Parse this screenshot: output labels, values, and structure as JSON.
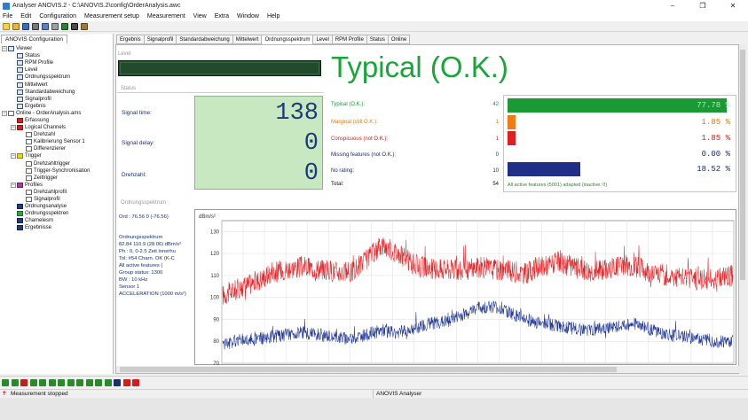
{
  "window": {
    "title": "Analyser ANOVIS.2 - C:\\ANOVIS.2\\config\\OrderAnalysis.awc",
    "minimize": "–",
    "restore": "❐",
    "close": "✕"
  },
  "menu": [
    "File",
    "Edit",
    "Configuration",
    "Measurement setup",
    "Measurement",
    "View",
    "Extra",
    "Window",
    "Help"
  ],
  "left_panel": {
    "tab_label": "ANOVIS Configuration",
    "tree": [
      {
        "label": "Viewer",
        "depth": 0,
        "icon": "viewer-icon",
        "exp": "−"
      },
      {
        "label": "Status",
        "depth": 1,
        "icon": "chart-icon"
      },
      {
        "label": "RPM Profile",
        "depth": 1,
        "icon": "chart-icon"
      },
      {
        "label": "Level",
        "depth": 1,
        "icon": "chart-icon"
      },
      {
        "label": "Ordnungsspektrum",
        "depth": 1,
        "icon": "chart-icon"
      },
      {
        "label": "Mittelwert",
        "depth": 1,
        "icon": "chart-icon"
      },
      {
        "label": "Standardabweichung",
        "depth": 1,
        "icon": "chart-icon"
      },
      {
        "label": "Signalprofil",
        "depth": 1,
        "icon": "chart-icon"
      },
      {
        "label": "Ergebnis",
        "depth": 1,
        "icon": "chart-icon"
      },
      {
        "label": "Online - OrderAnalysis.ams",
        "depth": 0,
        "icon": "online-icon",
        "exp": "−"
      },
      {
        "label": "Erfassung",
        "depth": 1,
        "icon": "red-icon"
      },
      {
        "label": "Logical Channels",
        "depth": 1,
        "icon": "red-icon",
        "exp": "−"
      },
      {
        "label": "Drehzahl",
        "depth": 2,
        "icon": "doc-icon"
      },
      {
        "label": "Kalibrierung Sensor 1",
        "depth": 2,
        "icon": "doc-icon"
      },
      {
        "label": "Differenzierer",
        "depth": 2,
        "icon": "doc-icon"
      },
      {
        "label": "Trigger",
        "depth": 1,
        "icon": "yellow-icon",
        "exp": "−"
      },
      {
        "label": "Drehzahltrigger",
        "depth": 2,
        "icon": "doc-icon"
      },
      {
        "label": "Trigger-Synchronisation",
        "depth": 2,
        "icon": "doc-icon"
      },
      {
        "label": "Zeittrigger",
        "depth": 2,
        "icon": "doc-icon"
      },
      {
        "label": "Profiles",
        "depth": 1,
        "icon": "magenta-icon",
        "exp": "−"
      },
      {
        "label": "Drehzahlprofil",
        "depth": 2,
        "icon": "doc-icon"
      },
      {
        "label": "Signalprofil",
        "depth": 2,
        "icon": "doc-icon"
      },
      {
        "label": "Ordnungsanalyse",
        "depth": 1,
        "icon": "dark-icon"
      },
      {
        "label": "Ordnungsspektren",
        "depth": 1,
        "icon": "green-icon"
      },
      {
        "label": "Chamelesm",
        "depth": 1,
        "icon": "dark-icon"
      },
      {
        "label": "Ergebnisse",
        "depth": 1,
        "icon": "dark-icon"
      }
    ]
  },
  "tabs": [
    "Ergebnis",
    "Signalprofil",
    "Standardabweichung",
    "Mittelwert",
    "Ordnungsspektrum",
    "Level",
    "RPM Profile",
    "Status",
    "Online"
  ],
  "active_tab": "Ordnungsspektrum",
  "level": {
    "group_label": "Level"
  },
  "verdict": {
    "text": "Typical (O.K.)",
    "color": "#19a53a"
  },
  "status": {
    "group_label": "Status",
    "signal_time_label": "Signal time:",
    "signal_time_value": "138",
    "signal_delay_label": "Signal delay:",
    "signal_delay_value": "0",
    "drehzahl_label": "Drehzahl:",
    "drehzahl_value": "0"
  },
  "results": [
    {
      "label": "Typical (O.K.):",
      "count": "42",
      "color": "#1a9a34",
      "pct": "77.78 %",
      "bar_fraction": 1.0
    },
    {
      "label": "Marginal (still O.K.):",
      "count": "1",
      "color": "#f07c15",
      "pct": "1.85 %",
      "bar_fraction": 0.035
    },
    {
      "label": "Conspicuous (not O.K.):",
      "count": "1",
      "color": "#e02020",
      "pct": "1.85 %",
      "bar_fraction": 0.035
    },
    {
      "label": "Missing features (not O.K.):",
      "count": "0",
      "color": "#1a2f6e",
      "pct": "0.00 %",
      "bar_fraction": 0.0
    },
    {
      "label": "No rating:",
      "count": "10",
      "color": "#1f2f88",
      "pct": "18.52 %",
      "bar_fraction": 0.33
    }
  ],
  "total": {
    "label": "Total:",
    "count": "54"
  },
  "adapted_note": "All active features (5001) adapted (inactive: 0)",
  "ordnung": {
    "group_label": "Ordnungsspektrum",
    "info_lines": [
      "Ord :        76.56   0   (-76.56)",
      "Ordnungsspektrum",
      "82.84   110.9  (28.06) dBm/s²",
      "Ph :         0, 0-2.5 Zeit innerhu",
      "Tol:          #54 Charn. OK (K-C",
      "               All active features (",
      "               Group status: 1300",
      "BW :         10 kHz",
      "Sensor 1",
      "ACCELERATION (1000 m/s²)"
    ]
  },
  "chart_data": {
    "type": "line",
    "title": "",
    "ylabel": "dBm/s²",
    "xlabel": "",
    "ylim": [
      70,
      135
    ],
    "yticks": [
      130,
      120,
      110,
      100,
      90,
      80,
      70
    ],
    "grid": true,
    "series": [
      {
        "color": "#e3262a",
        "baseline": [
          101,
          104,
          107,
          111,
          113,
          114,
          113,
          112,
          111,
          117,
          124,
          120,
          115,
          113,
          113,
          112,
          114,
          113,
          112,
          111,
          114,
          116,
          114,
          112,
          113,
          115,
          114,
          111,
          110,
          109,
          108,
          109,
          110
        ],
        "noise": 5
      },
      {
        "color": "#243a96",
        "baseline": [
          78,
          81,
          81,
          82,
          83,
          84,
          83,
          82,
          81,
          83,
          85,
          84,
          86,
          88,
          89,
          92,
          95,
          96,
          93,
          90,
          88,
          87,
          86,
          85,
          86,
          87,
          88,
          85,
          83,
          82,
          81,
          80,
          80
        ],
        "noise": 3
      }
    ]
  },
  "status_bar": {
    "message": "Measurement stopped",
    "app": "ANOVIS Analyser"
  }
}
